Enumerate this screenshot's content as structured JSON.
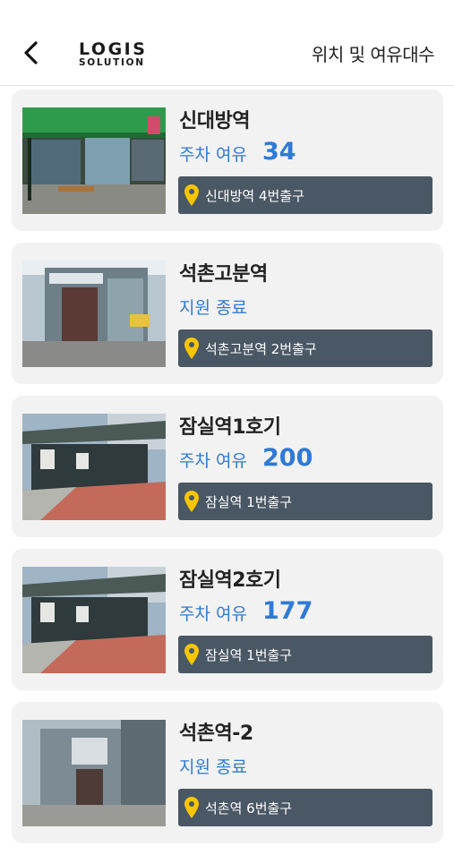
{
  "header": {
    "back_icon": "chevron-left-icon",
    "logo_line1": "LOGIS",
    "logo_line2": "SOLUTION",
    "title": "위치 및 여유대수"
  },
  "colors": {
    "accent_blue": "#2f7ad6",
    "location_bar": "#4a5764",
    "pin_yellow": "#f7c600",
    "card_bg": "#f2f2f2"
  },
  "stations": [
    {
      "name": "신대방역",
      "status": "주차 여유",
      "count": "34",
      "location": "신대방역 4번출구",
      "photo": "green-station-entrance"
    },
    {
      "name": "석촌고분역",
      "status": "지원 종료",
      "count": "",
      "location": "석촌고분역 2번출구",
      "photo": "glass-parking-booth"
    },
    {
      "name": "잠실역1호기",
      "status": "주차 여유",
      "count": "200",
      "location": "잠실역 1번출구",
      "photo": "street-parking-structure"
    },
    {
      "name": "잠실역2호기",
      "status": "주차 여유",
      "count": "177",
      "location": "잠실역 1번출구",
      "photo": "street-parking-structure"
    },
    {
      "name": "석촌역-2",
      "status": "지원 종료",
      "count": "",
      "location": "석촌역 6번출구",
      "photo": "glass-parking-booth-2"
    }
  ]
}
